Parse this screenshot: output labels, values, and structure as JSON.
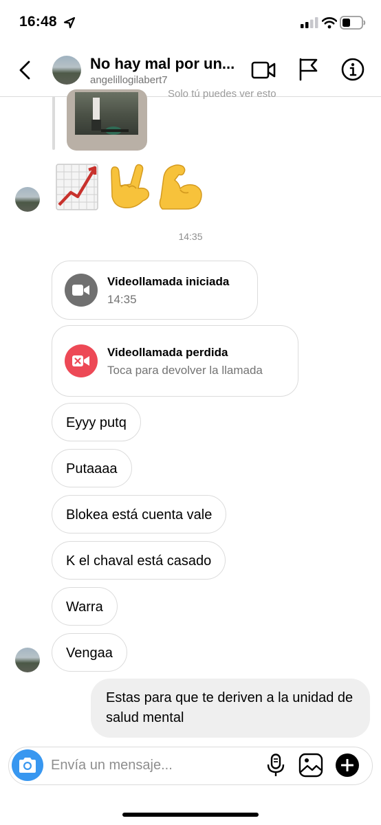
{
  "status_bar": {
    "time": "16:48"
  },
  "header": {
    "title": "No hay mal por un...",
    "username": "angelillogilabert7"
  },
  "shared_post": {
    "note": "Solo tú puedes ver esto"
  },
  "timestamp": "14:35",
  "calls": [
    {
      "title": "Videollamada iniciada",
      "subtitle": "14:35",
      "icon_color": "#707070"
    },
    {
      "title": "Videollamada perdida",
      "subtitle": "Toca para devolver la llamada",
      "icon_color": "#ed4956"
    }
  ],
  "incoming_messages": [
    "Eyyy putq",
    "Putaaaa",
    "Blokea está cuenta vale",
    "K el chaval está casado",
    "Warra",
    "Vengaa"
  ],
  "outgoing_message": "Estas para que te deriven a la unidad de salud mental",
  "composer": {
    "placeholder": "Envía un mensaje..."
  },
  "colors": {
    "accent_blue": "#3897f0",
    "missed_red": "#ed4956",
    "border": "#dbdbdb",
    "secondary_text": "#737373"
  }
}
